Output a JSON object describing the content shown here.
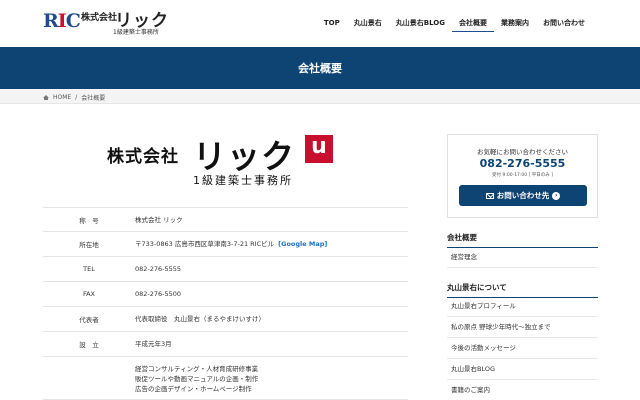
{
  "header": {
    "logo_mark_r": "R",
    "logo_mark_i": "I",
    "logo_mark_c": "C",
    "logo_company": "株式会社",
    "logo_name": "リック",
    "logo_sub": "1級建築士事務所",
    "nav": [
      "TOP",
      "丸山景右",
      "丸山景右BLOG",
      "会社概要",
      "業務案内",
      "お問い合わせ"
    ],
    "active_nav": "会社概要"
  },
  "banner": {
    "title": "会社概要"
  },
  "breadcrumb": {
    "home": "HOME",
    "separator": "/",
    "current": "会社概要"
  },
  "company_logo": {
    "company": "株式会社",
    "name": "リック",
    "badge": "u",
    "sub": "1級建築士事務所"
  },
  "table": {
    "rows": [
      {
        "label": "称　号",
        "value": "株式会社 リック"
      },
      {
        "label": "所在地",
        "value": "〒733-0863 広島市西区草津南3-7-21 RICビル",
        "link": "[Google Map]"
      },
      {
        "label": "TEL",
        "value": "082-276-5555"
      },
      {
        "label": "FAX",
        "value": "082-276-5500"
      },
      {
        "label": "代表者",
        "value": "代表取締役　丸山景右（まるやまけいすけ）"
      },
      {
        "label": "設　立",
        "value": "平成元年3月"
      }
    ],
    "business": {
      "lines": [
        "経営コンサルティング・人材育成研修事業",
        "販促ツールや動画マニュアルの企画・制作",
        "広告の企画デザイン・ホームページ制作"
      ]
    }
  },
  "sidebar": {
    "contact": {
      "lead": "お気軽にお問い合わせください",
      "phone": "082-276-5555",
      "hours": "受付 9:00-17:00 [ 平日のみ ]",
      "button": "お問い合わせ先"
    },
    "section1": {
      "title": "会社概要",
      "items": [
        "経営理念"
      ]
    },
    "section2": {
      "title": "丸山景右について",
      "items": [
        "丸山景右プロフィール",
        "私の原点 野球少年時代〜独立まで",
        "今後の活動メッセージ",
        "丸山景右BLOG",
        "書籍のご案内"
      ]
    }
  },
  "colors": {
    "brand": "#0e4474",
    "accent_red": "#c8102e"
  }
}
